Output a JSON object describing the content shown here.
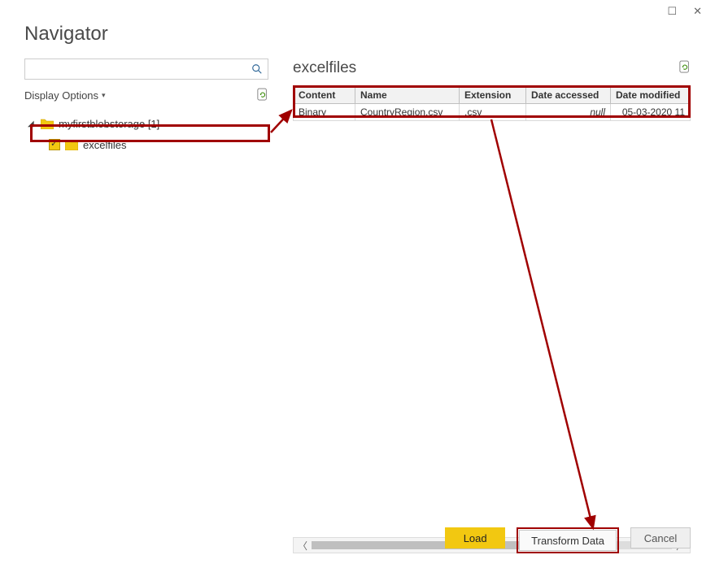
{
  "window": {
    "title": "Navigator"
  },
  "sidebar": {
    "display_options_label": "Display Options",
    "tree": {
      "root": {
        "label": "myfirstblobstorage [1]"
      },
      "child": {
        "label": "excelfiles"
      }
    }
  },
  "panel": {
    "title": "excelfiles",
    "columns": [
      "Content",
      "Name",
      "Extension",
      "Date accessed",
      "Date modified"
    ],
    "rows": [
      {
        "content": "Binary",
        "name": "CountryRegion.csv",
        "extension": ".csv",
        "dateAccessed": "null",
        "dateModified": "05-03-2020 11"
      }
    ]
  },
  "buttons": {
    "load": "Load",
    "transform": "Transform Data",
    "cancel": "Cancel"
  }
}
